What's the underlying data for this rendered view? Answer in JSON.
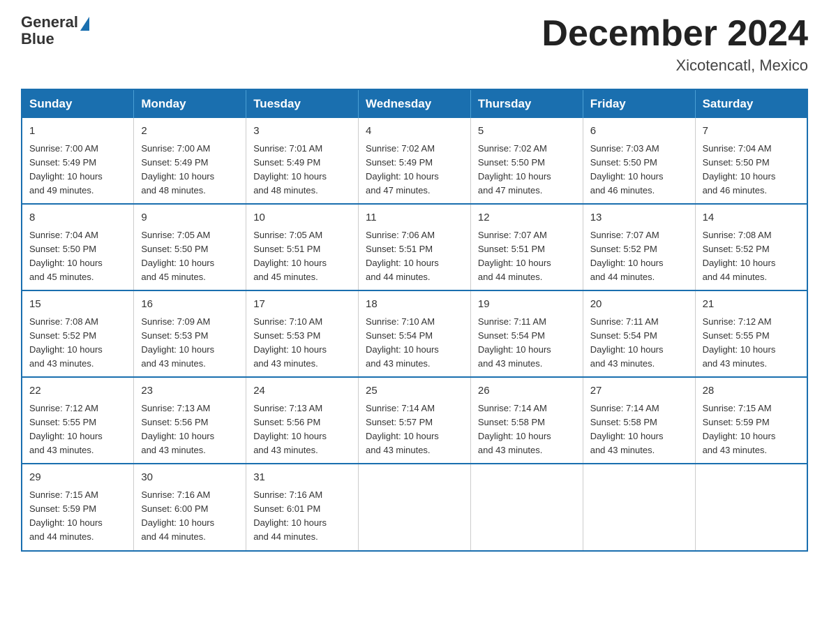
{
  "header": {
    "logo_line1": "General",
    "logo_line2": "Blue",
    "month_title": "December 2024",
    "location": "Xicotencatl, Mexico"
  },
  "weekdays": [
    "Sunday",
    "Monday",
    "Tuesday",
    "Wednesday",
    "Thursday",
    "Friday",
    "Saturday"
  ],
  "weeks": [
    [
      {
        "day": "1",
        "sunrise": "7:00 AM",
        "sunset": "5:49 PM",
        "daylight": "10 hours and 49 minutes."
      },
      {
        "day": "2",
        "sunrise": "7:00 AM",
        "sunset": "5:49 PM",
        "daylight": "10 hours and 48 minutes."
      },
      {
        "day": "3",
        "sunrise": "7:01 AM",
        "sunset": "5:49 PM",
        "daylight": "10 hours and 48 minutes."
      },
      {
        "day": "4",
        "sunrise": "7:02 AM",
        "sunset": "5:49 PM",
        "daylight": "10 hours and 47 minutes."
      },
      {
        "day": "5",
        "sunrise": "7:02 AM",
        "sunset": "5:50 PM",
        "daylight": "10 hours and 47 minutes."
      },
      {
        "day": "6",
        "sunrise": "7:03 AM",
        "sunset": "5:50 PM",
        "daylight": "10 hours and 46 minutes."
      },
      {
        "day": "7",
        "sunrise": "7:04 AM",
        "sunset": "5:50 PM",
        "daylight": "10 hours and 46 minutes."
      }
    ],
    [
      {
        "day": "8",
        "sunrise": "7:04 AM",
        "sunset": "5:50 PM",
        "daylight": "10 hours and 45 minutes."
      },
      {
        "day": "9",
        "sunrise": "7:05 AM",
        "sunset": "5:50 PM",
        "daylight": "10 hours and 45 minutes."
      },
      {
        "day": "10",
        "sunrise": "7:05 AM",
        "sunset": "5:51 PM",
        "daylight": "10 hours and 45 minutes."
      },
      {
        "day": "11",
        "sunrise": "7:06 AM",
        "sunset": "5:51 PM",
        "daylight": "10 hours and 44 minutes."
      },
      {
        "day": "12",
        "sunrise": "7:07 AM",
        "sunset": "5:51 PM",
        "daylight": "10 hours and 44 minutes."
      },
      {
        "day": "13",
        "sunrise": "7:07 AM",
        "sunset": "5:52 PM",
        "daylight": "10 hours and 44 minutes."
      },
      {
        "day": "14",
        "sunrise": "7:08 AM",
        "sunset": "5:52 PM",
        "daylight": "10 hours and 44 minutes."
      }
    ],
    [
      {
        "day": "15",
        "sunrise": "7:08 AM",
        "sunset": "5:52 PM",
        "daylight": "10 hours and 43 minutes."
      },
      {
        "day": "16",
        "sunrise": "7:09 AM",
        "sunset": "5:53 PM",
        "daylight": "10 hours and 43 minutes."
      },
      {
        "day": "17",
        "sunrise": "7:10 AM",
        "sunset": "5:53 PM",
        "daylight": "10 hours and 43 minutes."
      },
      {
        "day": "18",
        "sunrise": "7:10 AM",
        "sunset": "5:54 PM",
        "daylight": "10 hours and 43 minutes."
      },
      {
        "day": "19",
        "sunrise": "7:11 AM",
        "sunset": "5:54 PM",
        "daylight": "10 hours and 43 minutes."
      },
      {
        "day": "20",
        "sunrise": "7:11 AM",
        "sunset": "5:54 PM",
        "daylight": "10 hours and 43 minutes."
      },
      {
        "day": "21",
        "sunrise": "7:12 AM",
        "sunset": "5:55 PM",
        "daylight": "10 hours and 43 minutes."
      }
    ],
    [
      {
        "day": "22",
        "sunrise": "7:12 AM",
        "sunset": "5:55 PM",
        "daylight": "10 hours and 43 minutes."
      },
      {
        "day": "23",
        "sunrise": "7:13 AM",
        "sunset": "5:56 PM",
        "daylight": "10 hours and 43 minutes."
      },
      {
        "day": "24",
        "sunrise": "7:13 AM",
        "sunset": "5:56 PM",
        "daylight": "10 hours and 43 minutes."
      },
      {
        "day": "25",
        "sunrise": "7:14 AM",
        "sunset": "5:57 PM",
        "daylight": "10 hours and 43 minutes."
      },
      {
        "day": "26",
        "sunrise": "7:14 AM",
        "sunset": "5:58 PM",
        "daylight": "10 hours and 43 minutes."
      },
      {
        "day": "27",
        "sunrise": "7:14 AM",
        "sunset": "5:58 PM",
        "daylight": "10 hours and 43 minutes."
      },
      {
        "day": "28",
        "sunrise": "7:15 AM",
        "sunset": "5:59 PM",
        "daylight": "10 hours and 43 minutes."
      }
    ],
    [
      {
        "day": "29",
        "sunrise": "7:15 AM",
        "sunset": "5:59 PM",
        "daylight": "10 hours and 44 minutes."
      },
      {
        "day": "30",
        "sunrise": "7:16 AM",
        "sunset": "6:00 PM",
        "daylight": "10 hours and 44 minutes."
      },
      {
        "day": "31",
        "sunrise": "7:16 AM",
        "sunset": "6:01 PM",
        "daylight": "10 hours and 44 minutes."
      },
      null,
      null,
      null,
      null
    ]
  ],
  "labels": {
    "sunrise": "Sunrise:",
    "sunset": "Sunset:",
    "daylight": "Daylight:"
  }
}
